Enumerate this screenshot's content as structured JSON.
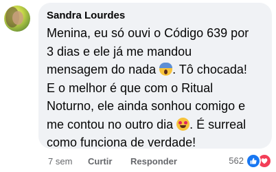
{
  "comment": {
    "author": "Sandra Lourdes",
    "text_lines": [
      "Menina, eu só ouvi o Código 639 por",
      "3 dias e ele já me mandou",
      "mensagem do nada",
      ". Tô chocada!",
      "E o melhor é que com o Ritual",
      "Noturno, ele ainda sonhou comigo e",
      "me contou no outro dia",
      ". É surreal",
      "como funciona de verdade!"
    ],
    "emojis": [
      "face-screaming-in-fear-icon",
      "smiling-face-with-heart-eyes-icon"
    ]
  },
  "actions": {
    "time": "7 sem",
    "like_label": "Curtir",
    "reply_label": "Responder"
  },
  "reactions": {
    "count": "562",
    "types": [
      "like-icon",
      "love-icon"
    ],
    "colors": {
      "like": "#1877f2",
      "love": "#f33e58"
    }
  },
  "colors": {
    "bubble_bg": "#f0f2f5",
    "text": "#050505",
    "secondary_text": "#65676b"
  }
}
